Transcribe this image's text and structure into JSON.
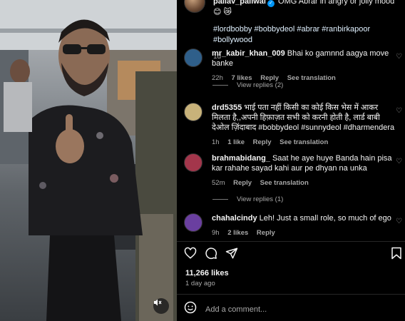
{
  "post": {
    "username": "pallav_paliwal",
    "caption_text": "OMG Abrar in angry or jolly mood 😊 😿",
    "hashtags": "#lordbobby #bobbydeol #abrar #ranbirkapoor #bollywood",
    "time": "1d"
  },
  "comments": [
    {
      "username": "mr_kabir_khan_009",
      "text": "Bhai ko gamnnd aagya move banke",
      "time": "22h",
      "likes": "7 likes",
      "reply": "Reply",
      "translation": "See translation",
      "view_replies": "View replies (2)",
      "avatar_color": "#2f5f8a"
    },
    {
      "username": "drd5355",
      "text": "भाई पता नहीं किसी का कोई किस भेस में आकर मिलता है,,अपनी हिफ़ाज़त सभी को करनी होती है, लार्ड बाबी देओल ज़िंदाबाद #bobbydeol #sunnydeol #dharmendera",
      "time": "1h",
      "likes": "1 like",
      "reply": "Reply",
      "translation": "See translation",
      "avatar_color": "#c8b27a"
    },
    {
      "username": "brahmabidang_",
      "text": "Saat he aye huye Banda hain pisa kar rahahe sayad kahi aur pe dhyan na unka",
      "time": "52m",
      "reply": "Reply",
      "translation": "See translation",
      "view_replies": "View replies (1)",
      "avatar_color": "#a3364b"
    },
    {
      "username": "chahalcindy",
      "text": "Leh! Just a small role, so much of ego",
      "time": "9h",
      "likes": "2 likes",
      "reply": "Reply",
      "avatar_color": "#6a3fa0"
    }
  ],
  "stats": {
    "likes": "11,266 likes",
    "ago": "1 day ago"
  },
  "composer": {
    "placeholder": "Add a comment..."
  },
  "icons": {
    "like": "heart-icon",
    "comment": "comment-icon",
    "share": "send-icon",
    "save": "bookmark-icon",
    "emoji": "emoji-icon",
    "mute": "speaker-muted-icon"
  },
  "colors": {
    "background": "#000000",
    "text": "#f5f5f5",
    "muted": "#a8a8a8",
    "verified": "#0095f6"
  }
}
